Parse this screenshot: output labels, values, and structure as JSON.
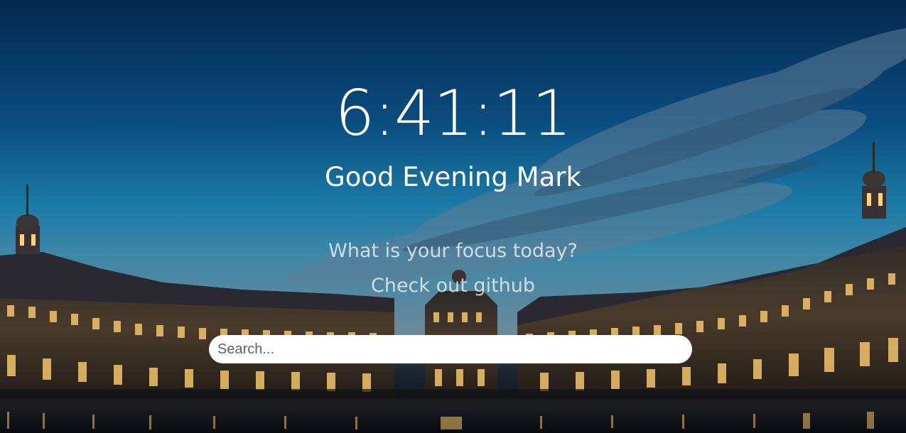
{
  "clock": {
    "time": "6:41:11"
  },
  "greeting": {
    "text": "Good Evening Mark"
  },
  "focus": {
    "prompt": "What is your focus today?"
  },
  "links": {
    "github": "Check out github"
  },
  "search": {
    "placeholder": "Search...",
    "value": ""
  },
  "background": {
    "subject": "illuminated neoclassical palace square at dusk with reflecting pool",
    "sky_color": "#0a4a7a",
    "light_color": "#f3c36a"
  }
}
